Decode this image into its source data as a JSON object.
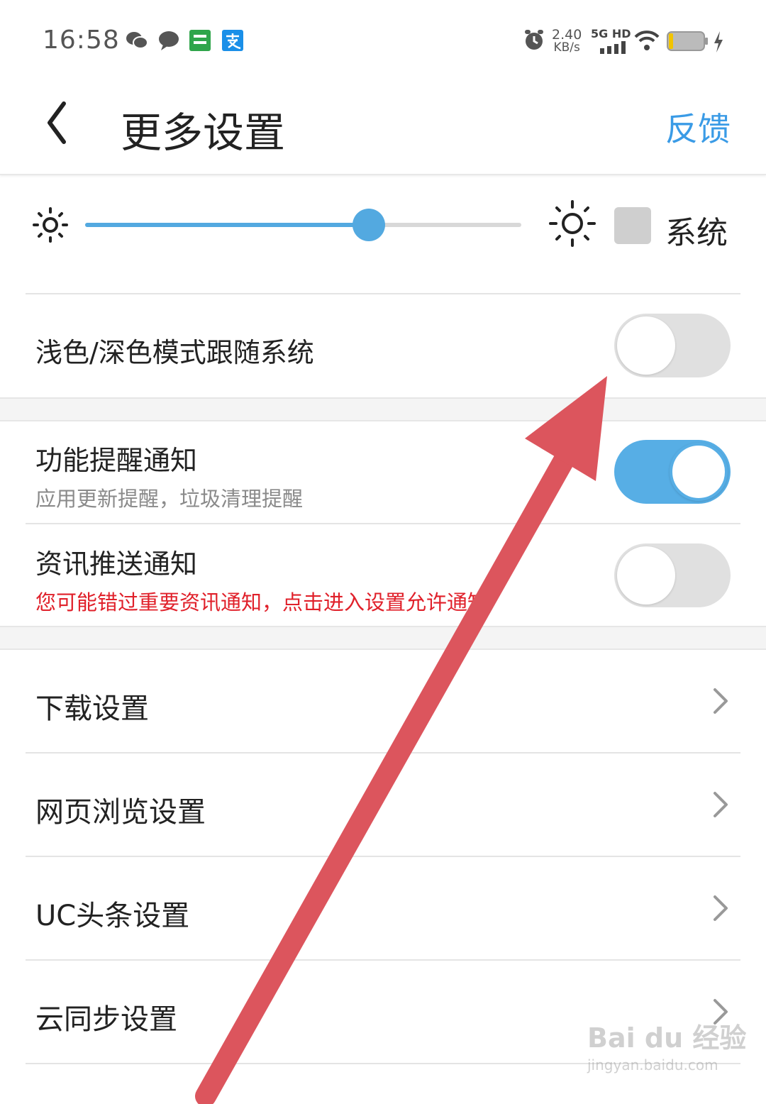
{
  "status_bar": {
    "time": "16:58",
    "net_speed_value": "2.40",
    "net_speed_unit": "KB/s",
    "signal_label": "5G HD",
    "icons": [
      "wechat-icon",
      "message-icon",
      "ringtone-app-icon",
      "alipay-icon",
      "alarm-icon",
      "signal-icon",
      "wifi-icon",
      "battery-icon",
      "charging-icon"
    ]
  },
  "header": {
    "title": "更多设置",
    "feedback": "反馈",
    "accent_color": "#3a9be6"
  },
  "brightness": {
    "level": 0.65,
    "system_label": "系统",
    "system_checked": false
  },
  "theme": {
    "label": "浅色/深色模式跟随系统",
    "enabled": false
  },
  "notifications": {
    "feature": {
      "title": "功能提醒通知",
      "subtitle": "应用更新提醒，垃圾清理提醒",
      "enabled": true
    },
    "news": {
      "title": "资讯推送通知",
      "warning": "您可能错过重要资讯通知，点击进入设置允许通知",
      "enabled": false
    }
  },
  "nav_items": [
    {
      "label": "下载设置"
    },
    {
      "label": "网页浏览设置"
    },
    {
      "label": "UC头条设置"
    },
    {
      "label": "云同步设置"
    }
  ],
  "watermark": {
    "main": "Bai du 经验",
    "sub": "jingyan.baidu.com"
  }
}
